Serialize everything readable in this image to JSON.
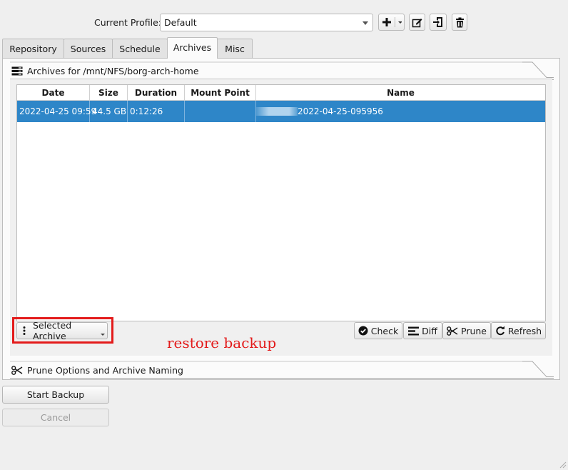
{
  "profile": {
    "label": "Current Profile:",
    "selected": "Default",
    "buttons": [
      "add-profile",
      "profile-menu",
      "edit-profile",
      "import-profile",
      "delete-profile"
    ]
  },
  "tabs": [
    {
      "label": "Repository",
      "active": false
    },
    {
      "label": "Sources",
      "active": false
    },
    {
      "label": "Schedule",
      "active": false
    },
    {
      "label": "Archives",
      "active": true
    },
    {
      "label": "Misc",
      "active": false
    }
  ],
  "archives_group": {
    "title": "Archives for /mnt/NFS/borg-arch-home"
  },
  "table": {
    "columns": [
      "Date",
      "Size",
      "Duration",
      "Mount Point",
      "Name"
    ],
    "rows": [
      {
        "date": "2022-04-25 09:59",
        "size": "44.5 GB",
        "duration": "0:12:26",
        "mount_point": "",
        "name": "2022-04-25-095956",
        "selected": true
      }
    ]
  },
  "actions": {
    "selected_archive": "Selected Archive",
    "check": "Check",
    "diff": "Diff",
    "prune": "Prune",
    "refresh": "Refresh"
  },
  "annotation": "restore backup",
  "annotation_color": "#e31b1b",
  "prune_group": {
    "title": "Prune Options and Archive Naming"
  },
  "bottom": {
    "start_backup": "Start Backup",
    "cancel": "Cancel"
  },
  "colors": {
    "selection": "#2e86c8"
  }
}
